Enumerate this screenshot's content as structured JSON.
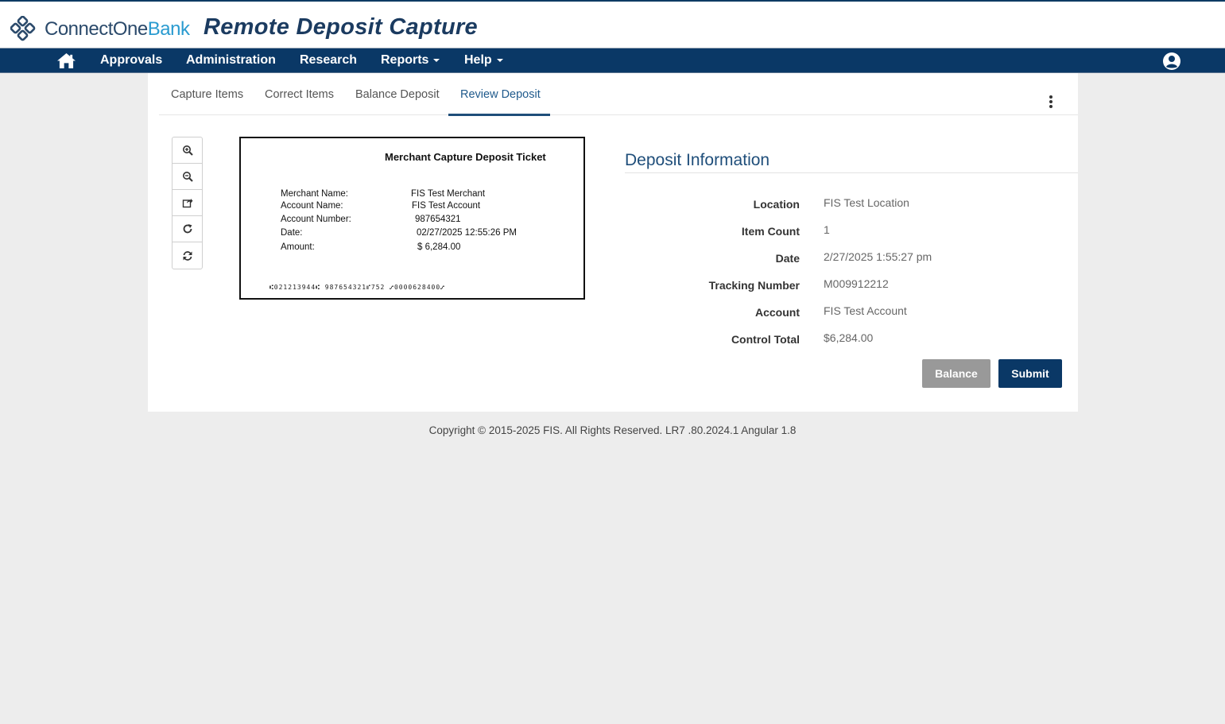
{
  "header": {
    "brand_part1": "ConnectOne",
    "brand_part2": "Bank",
    "app_title": "Remote Deposit Capture"
  },
  "nav": {
    "home_icon": "home-icon",
    "items": [
      {
        "label": "Approvals",
        "dropdown": false
      },
      {
        "label": "Administration",
        "dropdown": false
      },
      {
        "label": "Research",
        "dropdown": false
      },
      {
        "label": "Reports",
        "dropdown": true
      },
      {
        "label": "Help",
        "dropdown": true
      }
    ],
    "user_icon": "user-circle-icon"
  },
  "tabs": [
    {
      "label": "Capture Items",
      "active": false
    },
    {
      "label": "Correct Items",
      "active": false
    },
    {
      "label": "Balance Deposit",
      "active": false
    },
    {
      "label": "Review Deposit",
      "active": true
    }
  ],
  "image_tools": [
    "zoom-in-icon",
    "zoom-out-icon",
    "share-icon",
    "rotate-icon",
    "refresh-icon"
  ],
  "ticket": {
    "title": "Merchant Capture Deposit Ticket",
    "fields": [
      {
        "label": "Merchant Name:",
        "value": "FIS Test Merchant"
      },
      {
        "label": "Account Name:",
        "value": "FIS Test Account"
      },
      {
        "label": "Account Number:",
        "value": "987654321"
      },
      {
        "label": "Date:",
        "value": "02/27/2025 12:55:26 PM"
      },
      {
        "label": "Amount:",
        "value": "$ 6,284.00"
      }
    ],
    "micr_line": "⑆021213944⑆  987654321⑈752  ⑇0000628400⑇"
  },
  "deposit_info": {
    "title": "Deposit Information",
    "rows": [
      {
        "label": "Location",
        "value": "FIS Test Location"
      },
      {
        "label": "Item Count",
        "value": "1"
      },
      {
        "label": "Date",
        "value": "2/27/2025 1:55:27 pm"
      },
      {
        "label": "Tracking Number",
        "value": "M009912212"
      },
      {
        "label": "Account",
        "value": "FIS Test Account"
      },
      {
        "label": "Control Total",
        "value": "$6,284.00"
      }
    ],
    "balance_label": "Balance",
    "submit_label": "Submit"
  },
  "footer": {
    "text": "Copyright © 2015-2025 FIS. All Rights Reserved. LR7 .80.2024.1 Angular 1.8"
  },
  "colors": {
    "nav_bg": "#0a3866",
    "accent": "#1f4e7a",
    "brand_blue": "#2a9bd0",
    "balance_btn": "#999999"
  }
}
